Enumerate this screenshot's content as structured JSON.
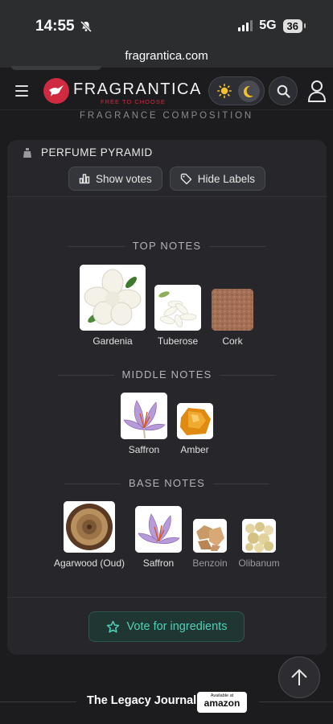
{
  "status": {
    "time": "14:55",
    "network": "5G",
    "battery": "36"
  },
  "browser": {
    "url": "fragrantica.com"
  },
  "header": {
    "logo_text": "FRAGRANTICA",
    "logo_sub": "FREE TO CHOOSE"
  },
  "section_heading": "FRAGRANCE COMPOSITION",
  "pyramid": {
    "title": "PERFUME PYRAMID",
    "show_votes": "Show votes",
    "hide_labels": "Hide Labels",
    "top": {
      "heading": "TOP NOTES",
      "notes": [
        "Gardenia",
        "Tuberose",
        "Cork"
      ]
    },
    "middle": {
      "heading": "MIDDLE NOTES",
      "notes": [
        "Saffron",
        "Amber"
      ]
    },
    "base": {
      "heading": "BASE NOTES",
      "notes": [
        "Agarwood (Oud)",
        "Saffron",
        "Benzoin",
        "Olibanum"
      ]
    },
    "vote_button": "Vote for ingredients"
  },
  "footer": {
    "legacy": "The Legacy Journal",
    "badge_small": "Available at",
    "badge_big": "amazon"
  },
  "colors": {
    "brand": "#d02a41",
    "accent": "#4fd1b5",
    "background": "#1c1c1f",
    "card": "#27272b"
  },
  "icons": [
    "bell-slash-icon",
    "signal-icon",
    "menu-icon",
    "sun-icon",
    "moon-icon",
    "search-icon",
    "user-icon",
    "pyramid-icon",
    "bar-chart-icon",
    "tag-icon",
    "star-icon",
    "arrow-up-icon"
  ]
}
